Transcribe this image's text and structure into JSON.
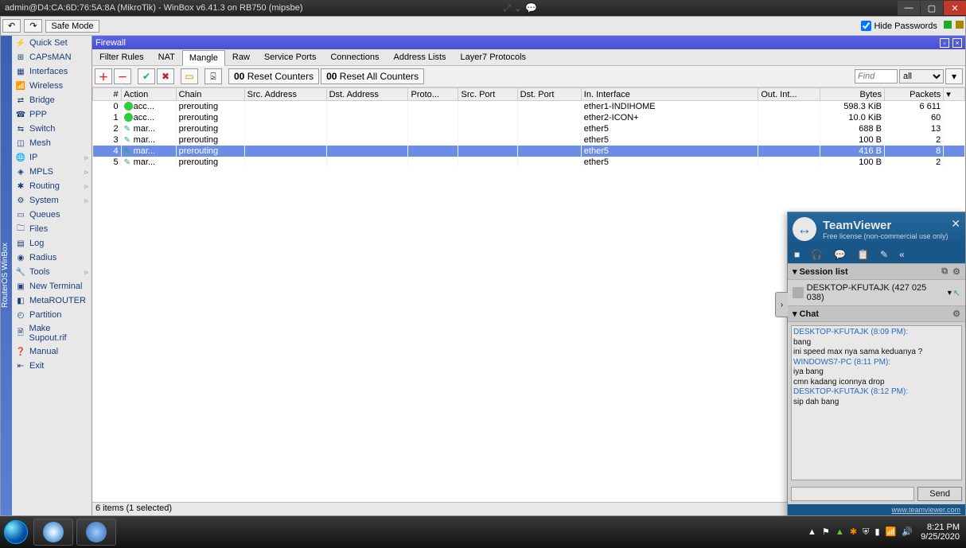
{
  "titlebar": {
    "text": "admin@D4:CA:6D:76:5A:8A (MikroTik) - WinBox v6.41.3 on RB750 (mipsbe)"
  },
  "toolbar": {
    "undo": "↶",
    "redo": "↷",
    "safemode": "Safe Mode",
    "hidepw_label": "Hide Passwords"
  },
  "sidebar": {
    "vtitle": "RouterOS WinBox",
    "items": [
      {
        "icon": "⚡",
        "label": "Quick Set"
      },
      {
        "icon": "⊞",
        "label": "CAPsMAN"
      },
      {
        "icon": "▦",
        "label": "Interfaces"
      },
      {
        "icon": "📶",
        "label": "Wireless"
      },
      {
        "icon": "⇄",
        "label": "Bridge"
      },
      {
        "icon": "☎",
        "label": "PPP"
      },
      {
        "icon": "⇆",
        "label": "Switch"
      },
      {
        "icon": "◫",
        "label": "Mesh"
      },
      {
        "icon": "🌐",
        "label": "IP",
        "sub": true
      },
      {
        "icon": "◈",
        "label": "MPLS",
        "sub": true
      },
      {
        "icon": "✱",
        "label": "Routing",
        "sub": true
      },
      {
        "icon": "⚙",
        "label": "System",
        "sub": true
      },
      {
        "icon": "▭",
        "label": "Queues"
      },
      {
        "icon": "🗀",
        "label": "Files"
      },
      {
        "icon": "▤",
        "label": "Log"
      },
      {
        "icon": "◉",
        "label": "Radius"
      },
      {
        "icon": "🔧",
        "label": "Tools",
        "sub": true
      },
      {
        "icon": "▣",
        "label": "New Terminal"
      },
      {
        "icon": "◧",
        "label": "MetaROUTER"
      },
      {
        "icon": "◴",
        "label": "Partition"
      },
      {
        "icon": "🗎",
        "label": "Make Supout.rif"
      },
      {
        "icon": "❓",
        "label": "Manual"
      },
      {
        "icon": "⇤",
        "label": "Exit"
      }
    ]
  },
  "firewall": {
    "title": "Firewall",
    "tabs": [
      "Filter Rules",
      "NAT",
      "Mangle",
      "Raw",
      "Service Ports",
      "Connections",
      "Address Lists",
      "Layer7 Protocols"
    ],
    "active_tab": 2,
    "actionbar": {
      "add": "＋",
      "remove": "－",
      "enable": "✔",
      "disable": "✖",
      "comment": "▭",
      "filter": "⍄",
      "reset": "Reset Counters",
      "reset_prefix": "00",
      "resetall": "Reset All Counters",
      "resetall_prefix": "00",
      "find_ph": "Find",
      "all": "all"
    },
    "columns": [
      "#",
      "Action",
      "Chain",
      "Src. Address",
      "Dst. Address",
      "Proto...",
      "Src. Port",
      "Dst. Port",
      "In. Interface",
      "Out. Int...",
      "Bytes",
      "Packets"
    ],
    "rows": [
      {
        "idx": "0",
        "action": "acc...",
        "atype": "acc",
        "chain": "prerouting",
        "ini": "ether1-INDIHOME",
        "bytes": "598.3 KiB",
        "packets": "6 611"
      },
      {
        "idx": "1",
        "action": "acc...",
        "atype": "acc",
        "chain": "prerouting",
        "ini": "ether2-ICON+",
        "bytes": "10.0 KiB",
        "packets": "60"
      },
      {
        "idx": "2",
        "action": "mar...",
        "atype": "mar",
        "chain": "prerouting",
        "ini": "ether5",
        "bytes": "688 B",
        "packets": "13"
      },
      {
        "idx": "3",
        "action": "mar...",
        "atype": "mar",
        "chain": "prerouting",
        "ini": "ether5",
        "bytes": "100 B",
        "packets": "2"
      },
      {
        "idx": "4",
        "action": "mar...",
        "atype": "mar",
        "chain": "prerouting",
        "ini": "ether5",
        "bytes": "416 B",
        "packets": "8",
        "sel": true
      },
      {
        "idx": "5",
        "action": "mar...",
        "atype": "mar",
        "chain": "prerouting",
        "ini": "ether5",
        "bytes": "100 B",
        "packets": "2"
      }
    ],
    "status": "6 items (1 selected)"
  },
  "tv": {
    "brand": "TeamViewer",
    "sub": "Free license (non-commercial use only)",
    "session_h": "Session list",
    "session": "DESKTOP-KFUTAJK (427 025 038)",
    "chat_h": "Chat",
    "messages": [
      {
        "s": "DESKTOP-KFUTAJK (8:09 PM):",
        "t": ""
      },
      {
        "s": "",
        "t": "bang"
      },
      {
        "s": "",
        "t": "ini speed max nya sama keduanya ?"
      },
      {
        "s": "WINDOWS7-PC (8:11 PM):",
        "t": ""
      },
      {
        "s": "",
        "t": "iya bang"
      },
      {
        "s": "",
        "t": "cmn kadang iconnya drop"
      },
      {
        "s": "DESKTOP-KFUTAJK (8:12 PM):",
        "t": ""
      },
      {
        "s": "",
        "t": "sip dah bang"
      }
    ],
    "send": "Send",
    "foot": "www.teamviewer.com"
  },
  "taskbar": {
    "time": "8:21 PM",
    "date": "9/25/2020"
  }
}
